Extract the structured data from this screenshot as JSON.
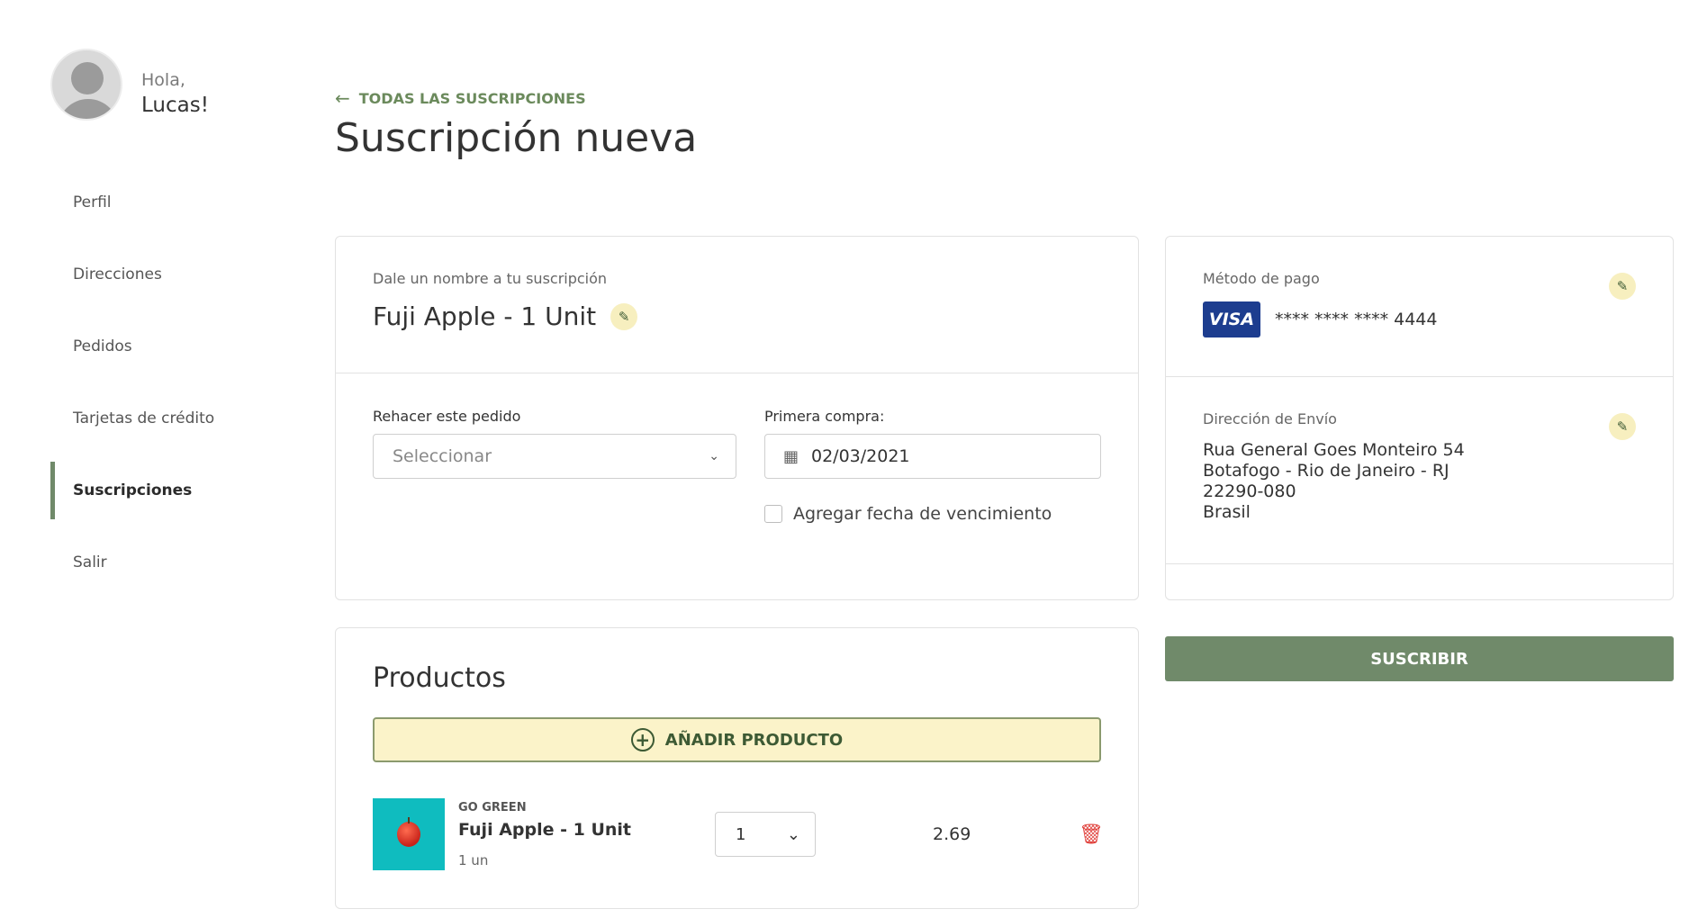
{
  "sidebar": {
    "greeting": "Hola,",
    "user_name": "Lucas!",
    "items": [
      {
        "label": "Perfil"
      },
      {
        "label": "Direcciones"
      },
      {
        "label": "Pedidos"
      },
      {
        "label": "Tarjetas de crédito"
      },
      {
        "label": "Suscripciones"
      },
      {
        "label": "Salir"
      }
    ],
    "active_item": "Suscripciones"
  },
  "header": {
    "back_label": "TODAS LAS SUSCRIPCIONES",
    "title": "Suscripción nueva"
  },
  "subscription": {
    "name_label": "Dale un nombre a tu suscripción",
    "name": "Fuji Apple - 1 Unit",
    "repeat_label": "Rehacer este pedido",
    "repeat_placeholder": "Seleccionar",
    "first_purchase_label": "Primera compra:",
    "first_purchase_date": "02/03/2021",
    "expiry_checkbox_label": "Agregar fecha de vencimiento"
  },
  "products": {
    "title": "Productos",
    "add_label": "AÑADIR PRODUCTO",
    "items": [
      {
        "brand": "GO GREEN",
        "name": "Fuji Apple - 1 Unit",
        "unit": "1 un",
        "quantity": "1",
        "price": "2.69"
      }
    ]
  },
  "payment": {
    "label": "Método de pago",
    "card_brand": "VISA",
    "card_number": "**** **** **** 4444"
  },
  "shipping": {
    "label": "Dirección de Envío",
    "lines": [
      "Rua General Goes Monteiro 54",
      "Botafogo - Rio de Janeiro - RJ",
      "22290-080",
      "Brasil"
    ]
  },
  "actions": {
    "subscribe_label": "SUSCRIBIR"
  },
  "colors": {
    "accent": "#708a6a",
    "highlight": "#fbf3c9",
    "danger": "#e0403b",
    "visa": "#1d3d8f"
  }
}
